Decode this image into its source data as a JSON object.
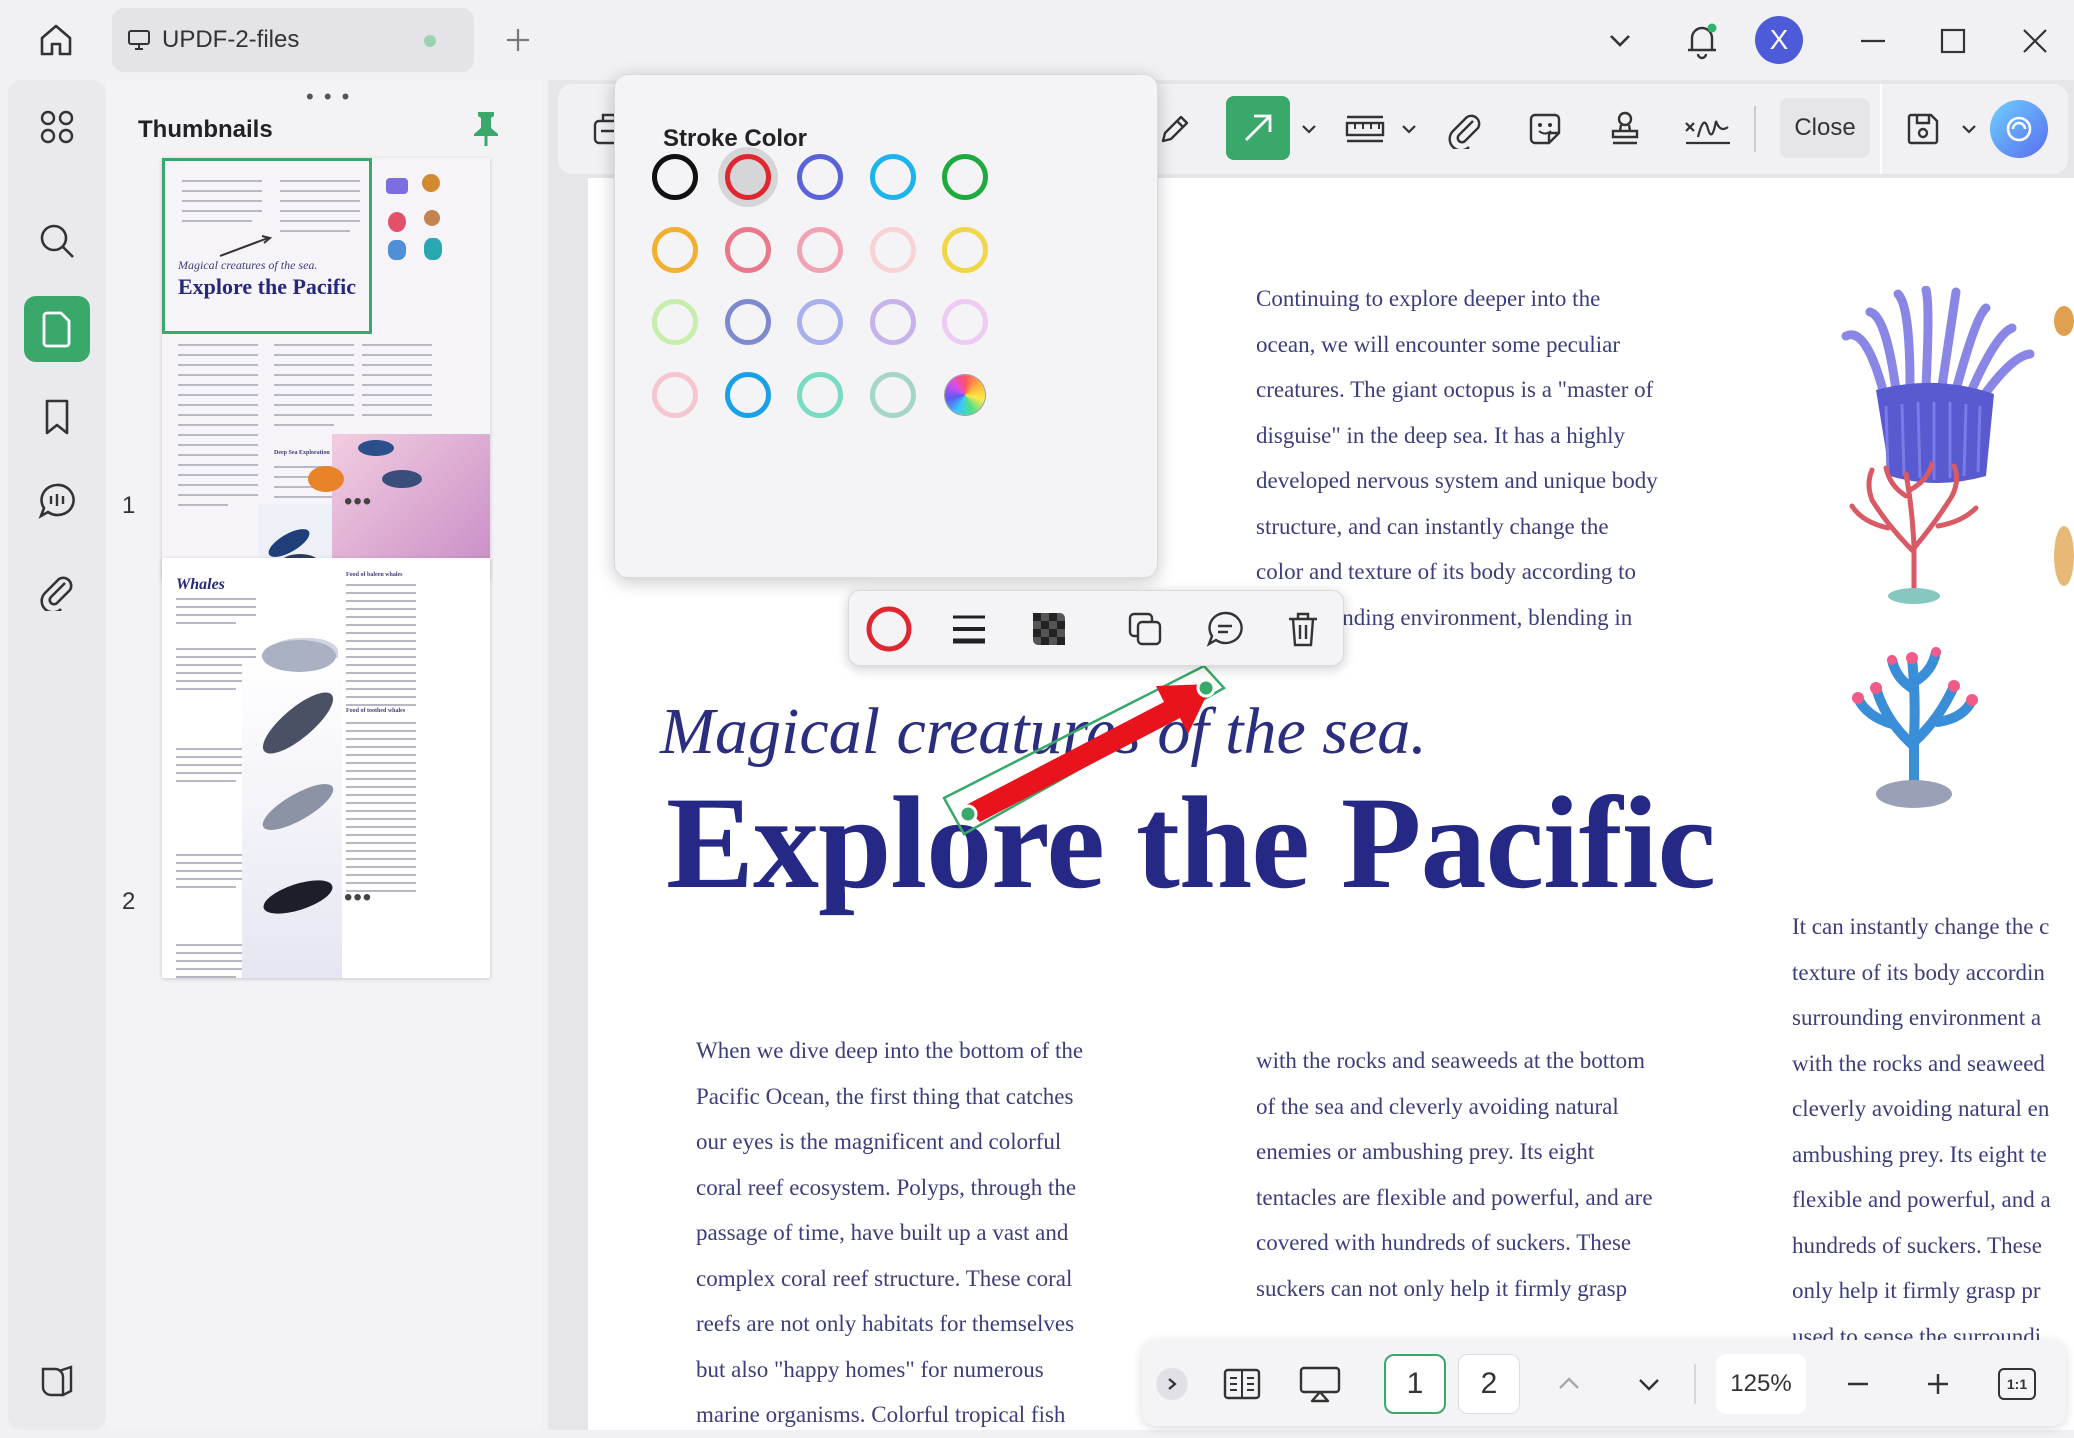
{
  "tab": {
    "title": "UPDF-2-files"
  },
  "user": {
    "initial": "X"
  },
  "thumbnails": {
    "title": "Thumbnails",
    "pages": [
      {
        "number": "1",
        "script_title": "Magical creatures of the sea.",
        "title": "Explore the Pacific",
        "section": "Deep Sea Exploration"
      },
      {
        "number": "2",
        "title": "Whales",
        "section_a": "Food of baleen whales",
        "section_b": "Food of toothed whales"
      }
    ]
  },
  "toolbar": {
    "close_label": "Close"
  },
  "stroke_color": {
    "title": "Stroke Color",
    "swatches": [
      "#111111",
      "#e0262f",
      "#5a63d8",
      "#1cb4ea",
      "#1faa3f",
      "#f2b032",
      "#e8798a",
      "#f2a3b3",
      "#f8d3d6",
      "#efd64b",
      "#c7eeaa",
      "#7e8ad0",
      "#aab0ec",
      "#c6b3ea",
      "#eecbf2",
      "#f6c6d0",
      "#1aa0e6",
      "#79dbc2",
      "#a5d6c8",
      "gradient"
    ],
    "selected_index": 1
  },
  "document": {
    "script_title": "Magical creatures of the sea.",
    "headline": "Explore the Pacific",
    "col_right_top": [
      "Continuing to explore deeper into the",
      "ocean, we will encounter some peculiar",
      "creatures. The giant octopus is a \"master of",
      "disguise\" in the deep sea. It has a highly",
      "developed nervous system and unique body",
      "structure, and can instantly change the",
      "color and texture of its body according to",
      "its surrounding environment, blending in"
    ],
    "col_left": [
      "When we dive deep into the bottom of the",
      "Pacific Ocean, the first thing that catches",
      "our eyes is the magnificent and colorful",
      "coral reef ecosystem. Polyps, through the",
      "passage of time, have built up a vast and",
      "complex coral reef structure. These coral",
      "reefs are not only habitats for themselves",
      "but also \"happy homes\" for numerous",
      "marine organisms. Colorful tropical fish"
    ],
    "col_mid": [
      "with the rocks and seaweeds at the bottom",
      "of the sea and cleverly avoiding natural",
      "enemies or ambushing prey. Its eight",
      "tentacles are flexible and powerful, and are",
      "covered with hundreds of suckers. These",
      "suckers can not only help it firmly grasp"
    ],
    "col_far": [
      "It can instantly change the c",
      "texture of its body accordin",
      "surrounding environment a",
      "with the rocks and seaweed",
      "cleverly avoiding natural en",
      "ambushing prey. Its eight te",
      "flexible and powerful, and a",
      "hundreds of suckers. These",
      "only help it firmly grasp pr",
      "used to sense the surroundi"
    ],
    "arrow_color": "#e8131c"
  },
  "bottom_nav": {
    "page_1": "1",
    "page_2": "2",
    "zoom": "125%",
    "fit_label": "1:1"
  }
}
